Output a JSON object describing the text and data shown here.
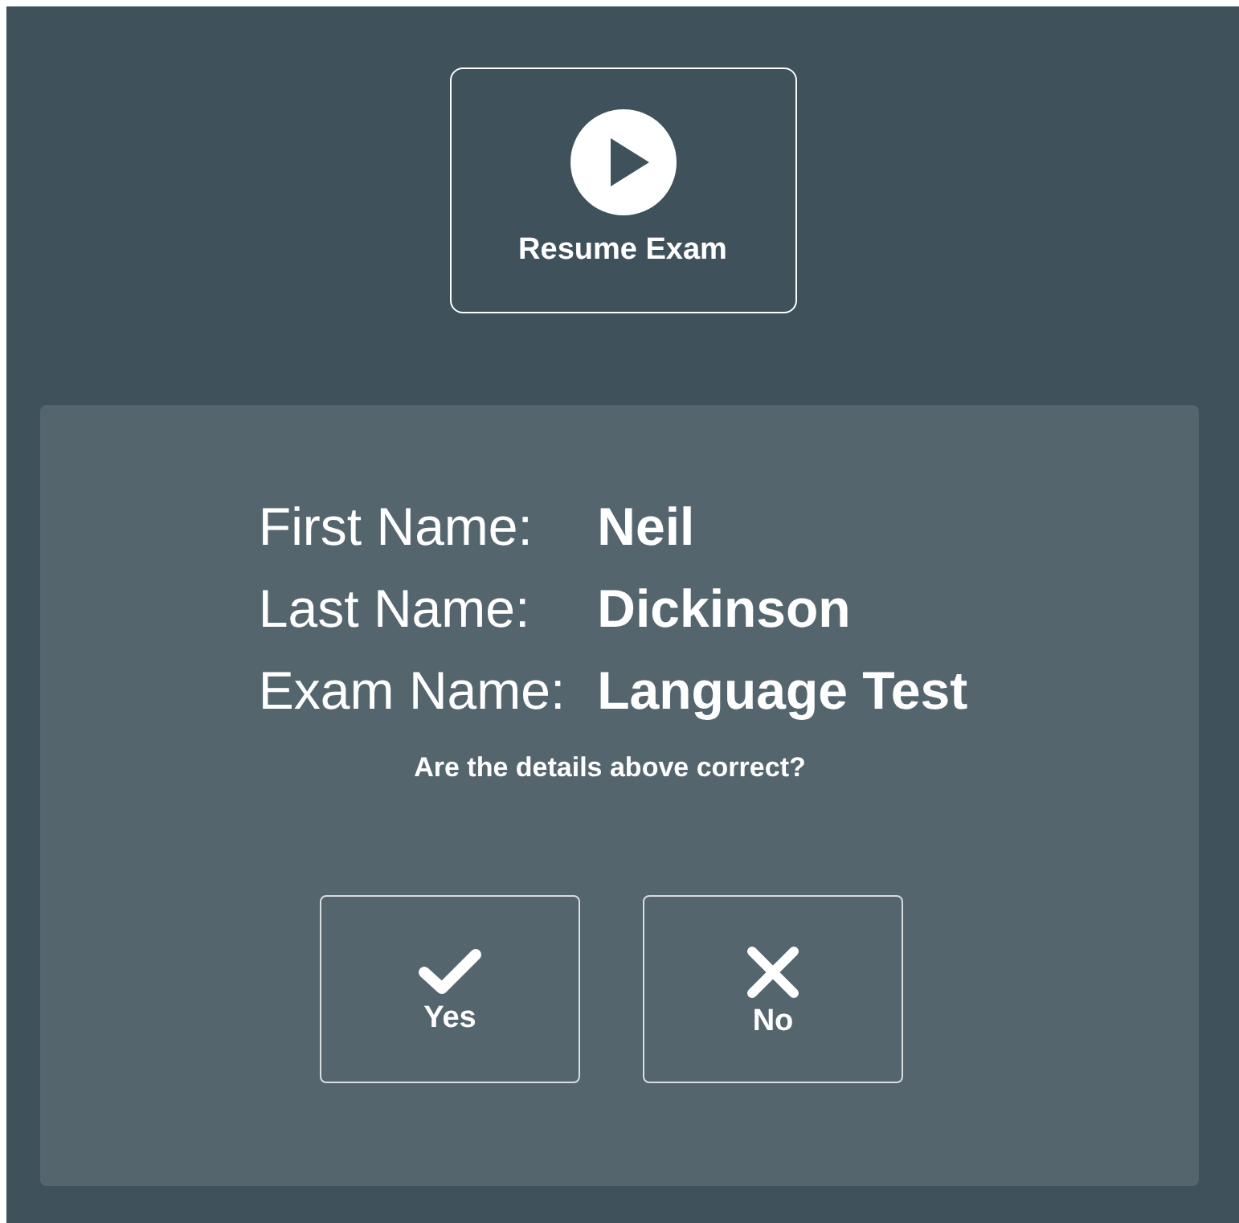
{
  "resume_button": {
    "label": "Resume Exam"
  },
  "details": [
    {
      "label": "First Name:",
      "value": "Neil"
    },
    {
      "label": "Last Name:",
      "value": "Dickinson"
    },
    {
      "label": "Exam Name:",
      "value": "Language Test"
    }
  ],
  "question": "Are the details above correct?",
  "buttons": [
    {
      "kind": "check",
      "label": "Yes"
    },
    {
      "kind": "cross",
      "label": "No"
    }
  ]
}
